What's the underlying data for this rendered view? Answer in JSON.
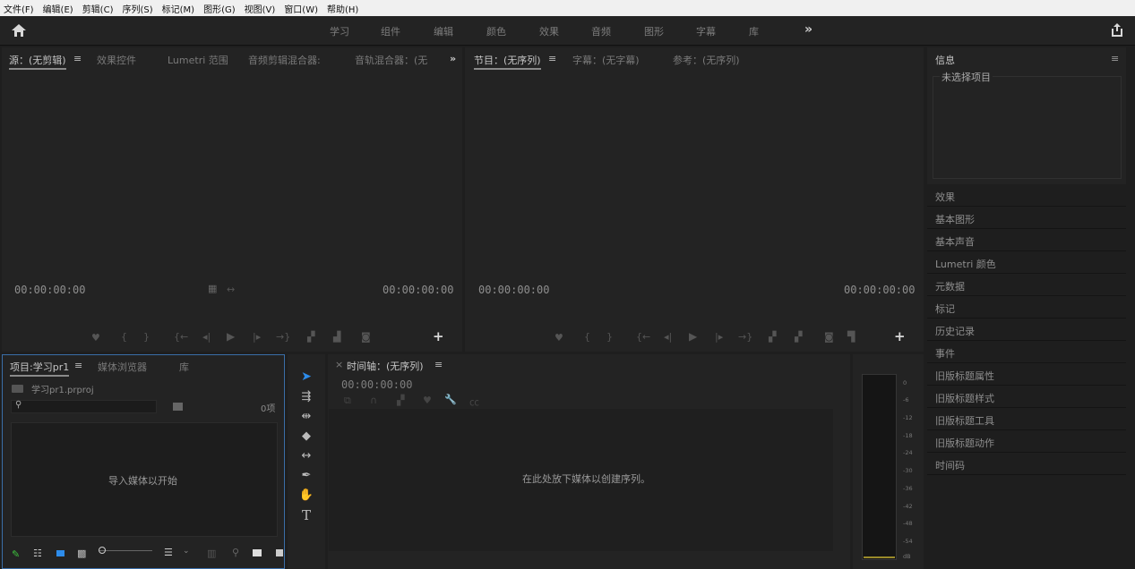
{
  "menu": [
    "文件(F)",
    "编辑(E)",
    "剪辑(C)",
    "序列(S)",
    "标记(M)",
    "图形(G)",
    "视图(V)",
    "窗口(W)",
    "帮助(H)"
  ],
  "workspaces": [
    "学习",
    "组件",
    "编辑",
    "颜色",
    "效果",
    "音频",
    "图形",
    "字幕",
    "库"
  ],
  "workspace_more": "»",
  "source_panel": {
    "tabs": [
      "源：(无剪辑)",
      "效果控件",
      "Lumetri 范围",
      "音频剪辑混合器:",
      "音轨混合器：(无"
    ],
    "more": "»",
    "menu": "≡",
    "timecode_left": "00:00:00:00",
    "timecode_right": "00:00:00:00"
  },
  "program_panel": {
    "tabs": [
      "节目：(无序列)",
      "字幕：(无字幕)",
      "参考：(无序列)"
    ],
    "menu": "≡",
    "timecode_left": "00:00:00:00",
    "timecode_right": "00:00:00:00"
  },
  "info_panel": {
    "title": "信息",
    "menu": "≡",
    "empty_text": "未选择项目"
  },
  "side_panels": [
    "效果",
    "基本图形",
    "基本声音",
    "Lumetri 颜色",
    "元数据",
    "标记",
    "历史记录",
    "事件",
    "旧版标题属性",
    "旧版标题样式",
    "旧版标题工具",
    "旧版标题动作",
    "时间码"
  ],
  "project_panel": {
    "tabs": [
      "项目:学习pr1",
      "媒体浏览器",
      "库"
    ],
    "menu": "≡",
    "file_name": "学习pr1.prproj",
    "item_count": "0项",
    "search_placeholder": "",
    "empty_text": "导入媒体以开始"
  },
  "timeline_panel": {
    "close": "×",
    "title": "时间轴：(无序列)",
    "menu": "≡",
    "timecode": "00:00:00:00",
    "empty_text": "在此处放下媒体以创建序列。"
  },
  "meter": {
    "labels": [
      "0",
      "-6",
      "-12",
      "-18",
      "-24",
      "-30",
      "-36",
      "-42",
      "-48",
      "-54",
      "dB"
    ]
  },
  "colors": {
    "accent": "#2d8ceb",
    "panel_bg": "#232323",
    "app_bg": "#1e1e1e",
    "active_panel_border": "#3a6ea8"
  }
}
